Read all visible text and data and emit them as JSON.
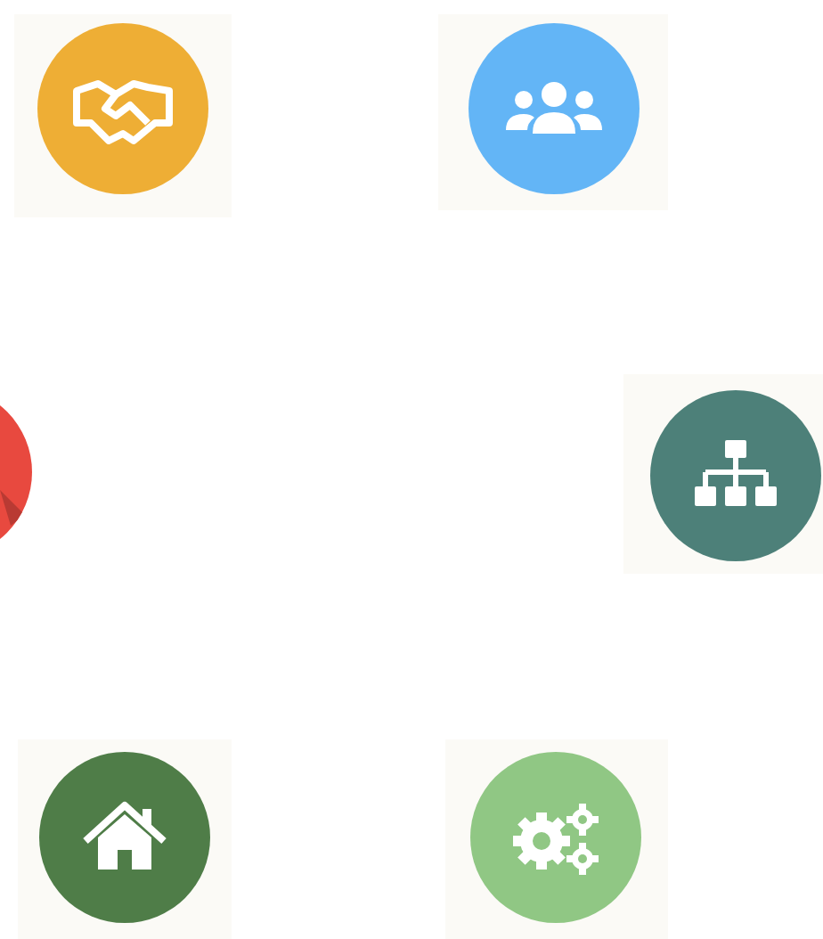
{
  "icons": [
    {
      "kind": "handshake",
      "color": "#eeae35"
    },
    {
      "kind": "users",
      "color": "#63b5f6"
    },
    {
      "kind": "partial",
      "color": "#e8493f"
    },
    {
      "kind": "org-chart",
      "color": "#4d8079"
    },
    {
      "kind": "home",
      "color": "#4f7d48"
    },
    {
      "kind": "gears",
      "color": "#90c784"
    }
  ]
}
